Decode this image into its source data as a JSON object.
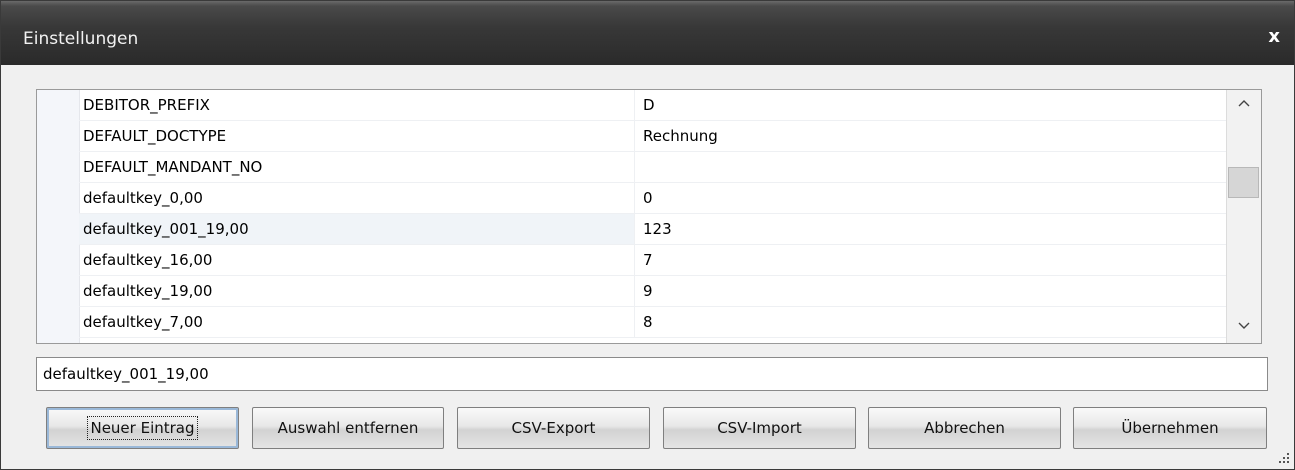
{
  "window": {
    "title": "Einstellungen",
    "close_label": "x"
  },
  "grid": {
    "rows": [
      {
        "key": "DEBITOR_PREFIX",
        "value": "D"
      },
      {
        "key": "DEFAULT_DOCTYPE",
        "value": "Rechnung"
      },
      {
        "key": "DEFAULT_MANDANT_NO",
        "value": ""
      },
      {
        "key": "defaultkey_0,00",
        "value": "0"
      },
      {
        "key": "defaultkey_001_19,00",
        "value": "123"
      },
      {
        "key": "defaultkey_16,00",
        "value": "7"
      },
      {
        "key": "defaultkey_19,00",
        "value": "9"
      },
      {
        "key": "defaultkey_7,00",
        "value": "8"
      }
    ],
    "selected_index": 4,
    "scroll_up": "^",
    "scroll_down": "v"
  },
  "editor": {
    "value": "defaultkey_001_19,00"
  },
  "buttons": {
    "new": "Neuer Eintrag",
    "remove": "Auswahl entfernen",
    "export": "CSV-Export",
    "import": "CSV-Import",
    "cancel": "Abbrechen",
    "apply": "Übernehmen"
  },
  "colors": {
    "titlebar": "#2a2a2a",
    "dialog_bg": "#f0f0f0",
    "selected_row": "#f0f4f8"
  }
}
